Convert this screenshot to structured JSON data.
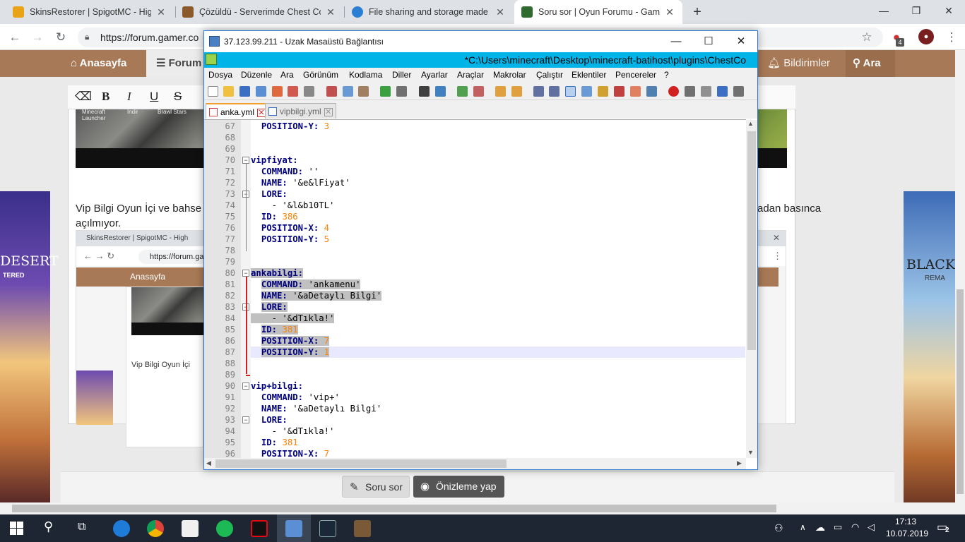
{
  "browser": {
    "tabs": [
      {
        "title": "SkinsRestorer | SpigotMC - High",
        "favicon_color": "#e8a317"
      },
      {
        "title": "Çözüldü - Serverimde Chest Com",
        "favicon_color": "#8a5a2b"
      },
      {
        "title": "File sharing and storage made si",
        "favicon_color": "#2a7fd4"
      },
      {
        "title": "Soru sor | Oyun Forumu - Gamer",
        "favicon_color": "#2f6b2f"
      }
    ],
    "new_tab": "+",
    "url": "https://forum.gamer.co",
    "notification_badge": "4"
  },
  "forum": {
    "nav": {
      "home": "Anasayfa",
      "forum": "Forum",
      "notifications": "Bildirimler",
      "search": "Ara"
    },
    "body_text_line1": "Vip Bilgi Oyun İçi ve bahse",
    "body_text_line1_end": "adan basınca",
    "body_text_line2": "açılmıyor.",
    "thumb_labels": {
      "launcher": "Minecraft Launcher",
      "download": "İndir",
      "brawl": "Brawl Stars"
    },
    "inner": {
      "tab_title": "SkinsRestorer | SpigotMC - High",
      "url": "https://forum.gam",
      "nav_home": "Anasayfa",
      "body_text": "Vip Bilgi Oyun İçi"
    },
    "ad_left_text": "DESERT",
    "ad_left_sub": "TERED",
    "ad_right_text": "BLACK",
    "ad_right_sub": "REMA",
    "buttons": {
      "ask": "Soru sor",
      "preview": "Önizleme yap"
    }
  },
  "rdp": {
    "title": "37.123.99.211 - Uzak Masaüstü Bağlantısı"
  },
  "notepad": {
    "path": "*C:\\Users\\minecraft\\Desktop\\minecraft-batihost\\plugins\\ChestCo",
    "menu": [
      "Dosya",
      "Düzenle",
      "Ara",
      "Görünüm",
      "Kodlama",
      "Diller",
      "Ayarlar",
      "Araçlar",
      "Makrolar",
      "Çalıştır",
      "Eklentiler",
      "Pencereler",
      "?"
    ],
    "tabs": [
      {
        "name": "anka.yml",
        "active": true
      },
      {
        "name": "vipbilgi.yml",
        "active": false
      }
    ],
    "lines": [
      {
        "n": "67",
        "parts": [
          {
            "t": "  "
          },
          {
            "t": "POSITION-Y:",
            "c": "k"
          },
          {
            "t": " "
          },
          {
            "t": "3",
            "c": "n"
          }
        ]
      },
      {
        "n": "68",
        "parts": []
      },
      {
        "n": "69",
        "parts": []
      },
      {
        "n": "70",
        "parts": [
          {
            "t": "vipfiyat:",
            "c": "k"
          }
        ]
      },
      {
        "n": "71",
        "parts": [
          {
            "t": "  "
          },
          {
            "t": "COMMAND:",
            "c": "k"
          },
          {
            "t": " ''"
          }
        ]
      },
      {
        "n": "72",
        "parts": [
          {
            "t": "  "
          },
          {
            "t": "NAME:",
            "c": "k"
          },
          {
            "t": " '&e&lFiyat'"
          }
        ]
      },
      {
        "n": "73",
        "parts": [
          {
            "t": "  "
          },
          {
            "t": "LORE:",
            "c": "k"
          }
        ]
      },
      {
        "n": "74",
        "parts": [
          {
            "t": "    - '&l&b10TL'"
          }
        ]
      },
      {
        "n": "75",
        "parts": [
          {
            "t": "  "
          },
          {
            "t": "ID:",
            "c": "k"
          },
          {
            "t": " "
          },
          {
            "t": "386",
            "c": "n"
          }
        ]
      },
      {
        "n": "76",
        "parts": [
          {
            "t": "  "
          },
          {
            "t": "POSITION-X:",
            "c": "k"
          },
          {
            "t": " "
          },
          {
            "t": "4",
            "c": "n"
          }
        ]
      },
      {
        "n": "77",
        "parts": [
          {
            "t": "  "
          },
          {
            "t": "POSITION-Y:",
            "c": "k"
          },
          {
            "t": " "
          },
          {
            "t": "5",
            "c": "n"
          }
        ]
      },
      {
        "n": "78",
        "parts": []
      },
      {
        "n": "79",
        "parts": []
      },
      {
        "n": "80",
        "parts": [
          {
            "t": "ankabilgi:",
            "c": "k"
          }
        ],
        "sel": true
      },
      {
        "n": "81",
        "parts": [
          {
            "t": "  "
          },
          {
            "t": "COMMAND:",
            "c": "k"
          },
          {
            "t": " 'ankamenu'"
          }
        ],
        "sel": true
      },
      {
        "n": "82",
        "parts": [
          {
            "t": "  "
          },
          {
            "t": "NAME:",
            "c": "k"
          },
          {
            "t": " '&aDetaylı Bilgi'"
          }
        ],
        "sel": true
      },
      {
        "n": "83",
        "parts": [
          {
            "t": "  "
          },
          {
            "t": "LORE:",
            "c": "k"
          }
        ],
        "sel": true
      },
      {
        "n": "84",
        "parts": [
          {
            "t": "    - '&dTıkla!'"
          }
        ],
        "sel": true
      },
      {
        "n": "85",
        "parts": [
          {
            "t": "  "
          },
          {
            "t": "ID:",
            "c": "k"
          },
          {
            "t": " "
          },
          {
            "t": "381",
            "c": "n"
          }
        ],
        "sel": true
      },
      {
        "n": "86",
        "parts": [
          {
            "t": "  "
          },
          {
            "t": "POSITION-X:",
            "c": "k"
          },
          {
            "t": " "
          },
          {
            "t": "7",
            "c": "n"
          }
        ],
        "sel": true
      },
      {
        "n": "87",
        "parts": [
          {
            "t": "  "
          },
          {
            "t": "POSITION-Y:",
            "c": "k"
          },
          {
            "t": " "
          },
          {
            "t": "1",
            "c": "n"
          }
        ],
        "sel": true,
        "current": true
      },
      {
        "n": "88",
        "parts": []
      },
      {
        "n": "89",
        "parts": []
      },
      {
        "n": "90",
        "parts": [
          {
            "t": "vip+bilgi:",
            "c": "k"
          }
        ]
      },
      {
        "n": "91",
        "parts": [
          {
            "t": "  "
          },
          {
            "t": "COMMAND:",
            "c": "k"
          },
          {
            "t": " 'vip+'"
          }
        ]
      },
      {
        "n": "92",
        "parts": [
          {
            "t": "  "
          },
          {
            "t": "NAME:",
            "c": "k"
          },
          {
            "t": " '&aDetaylı Bilgi'"
          }
        ]
      },
      {
        "n": "93",
        "parts": [
          {
            "t": "  "
          },
          {
            "t": "LORE:",
            "c": "k"
          }
        ]
      },
      {
        "n": "94",
        "parts": [
          {
            "t": "    - '&dTıkla!'"
          }
        ]
      },
      {
        "n": "95",
        "parts": [
          {
            "t": "  "
          },
          {
            "t": "ID:",
            "c": "k"
          },
          {
            "t": " "
          },
          {
            "t": "381",
            "c": "n"
          }
        ]
      },
      {
        "n": "96",
        "parts": [
          {
            "t": "  "
          },
          {
            "t": "POSITION-X:",
            "c": "k"
          },
          {
            "t": " "
          },
          {
            "t": "7",
            "c": "n"
          }
        ]
      }
    ],
    "fold_markers": [
      "70",
      "73",
      "80",
      "83",
      "90",
      "93"
    ]
  },
  "taskbar": {
    "apps": [
      "windows-start",
      "search",
      "task-view",
      "edge",
      "chrome",
      "store",
      "spotify",
      "netflix",
      "remote-desktop",
      "steam",
      "minecraft"
    ],
    "time": "17:13",
    "date": "10.07.2019",
    "notification_count": "2"
  }
}
